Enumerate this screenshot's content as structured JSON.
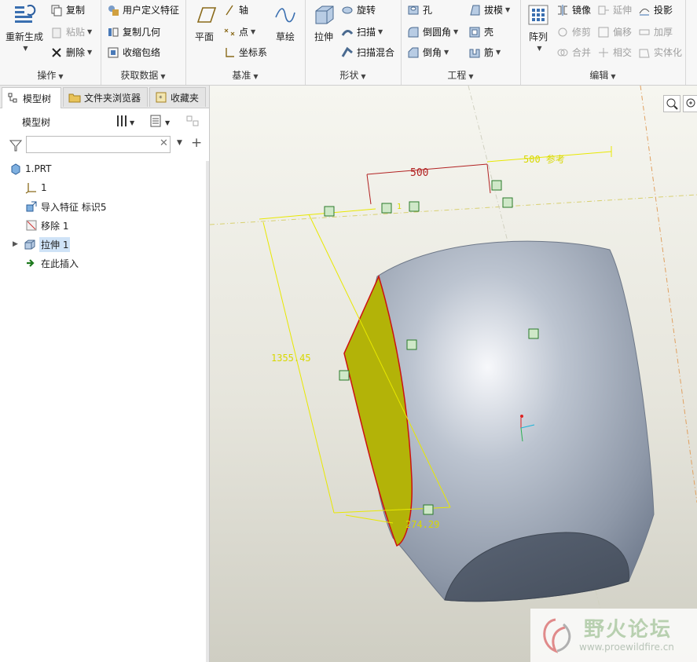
{
  "ribbon": {
    "groups": {
      "operations": {
        "label": "操作",
        "regenerate": "重新生成",
        "copy": "复制",
        "paste": "粘贴",
        "delete": "删除"
      },
      "get_data": {
        "label": "获取数据",
        "udf": "用户定义特征",
        "copy_geom": "复制几何",
        "shrinkwrap": "收缩包络"
      },
      "datum": {
        "label": "基准",
        "plane": "平面",
        "axis": "轴",
        "point": "点",
        "csys": "坐标系",
        "sketch": "草绘"
      },
      "shapes": {
        "label": "形状",
        "extrude": "拉伸",
        "revolve": "旋转",
        "sweep": "扫描",
        "swept_blend": "扫描混合"
      },
      "engineering": {
        "label": "工程",
        "hole": "孔",
        "draft": "拔模",
        "round": "倒圆角",
        "shell": "壳",
        "chamfer": "倒角",
        "rib": "筋"
      },
      "editing": {
        "label": "编辑",
        "pattern": "阵列",
        "mirror": "镜像",
        "extend": "延伸",
        "project": "投影",
        "trim": "修剪",
        "offset": "偏移",
        "thicken": "加厚",
        "merge": "合并",
        "intersect": "相交",
        "solidify": "实体化"
      }
    }
  },
  "left_panel": {
    "tabs": [
      "模型树",
      "文件夹浏览器",
      "收藏夹"
    ],
    "tree_title": "模型树",
    "filter_placeholder": "",
    "tree": [
      {
        "label": "1.PRT",
        "icon": "part-icon"
      },
      {
        "label": "1",
        "icon": "csys-icon"
      },
      {
        "label": "导入特征 标识5",
        "icon": "import-feature-icon"
      },
      {
        "label": "移除 1",
        "icon": "remove-icon"
      },
      {
        "label": "拉伸 1",
        "icon": "extrude-icon",
        "selected": true
      },
      {
        "label": "在此插入",
        "icon": "insert-here-arrow-icon"
      }
    ]
  },
  "viewport": {
    "dim_top": "500",
    "dim_ref": "500 参考",
    "dim_height": "1355.45",
    "dim_bottom": "274.29",
    "marker": "1",
    "colors": {
      "section_fill": "#b3b308",
      "dimension": "#e8e800",
      "body": "#a9b2c0"
    }
  },
  "watermark": {
    "title": "野火论坛",
    "url": "www.proewildfire.cn"
  }
}
